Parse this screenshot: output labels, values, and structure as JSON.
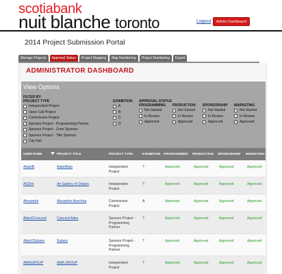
{
  "header": {
    "brand_top": "scotiabank",
    "brand_main": "nuit blanche",
    "brand_city": "toronto",
    "logout": "Logout",
    "admin_dashboard": "Admin Dashboard"
  },
  "portal_title": "2014 Project Submission Portal",
  "tabs": [
    {
      "label": "Manage Projects",
      "active": false
    },
    {
      "label": "Approval Status",
      "active": true
    },
    {
      "label": "Project Mapping",
      "active": false
    },
    {
      "label": "Map Numbering",
      "active": false
    },
    {
      "label": "Project Numbering",
      "active": false
    },
    {
      "label": "Export",
      "active": false
    }
  ],
  "dashboard_title": "ADMINISTRATOR DASHBOARD",
  "filters": {
    "heading": "View Options",
    "project_type": {
      "label_line1": "FILTER BY:",
      "label_line2": "PROJECT TYPE",
      "options": [
        "Independent Project",
        "Open Call Project",
        "Commission Project",
        "Sponsor Project - Programming Partner",
        "Sponsor Project - Zone Sponsor",
        "Sponsor Project - Title Sponsor",
        "City Hall"
      ]
    },
    "exhibition": {
      "label": "EXHIBITION",
      "options": [
        "A",
        "B",
        "C",
        "D"
      ]
    },
    "approval_status": {
      "label": "APPROVAL STATUS"
    },
    "programming": {
      "label": "PROGRAMMING",
      "options": [
        "Not Started",
        "In Review",
        "Approved"
      ]
    },
    "production": {
      "label": "PRODUCTION",
      "options": [
        "Not Started",
        "In Review",
        "Approved"
      ]
    },
    "sponsorship": {
      "label": "SPONSORSHIP",
      "options": [
        "Not Started",
        "In Review",
        "Approved"
      ]
    },
    "marketing": {
      "label": "MARKETING",
      "options": [
        "Not Started",
        "In Review",
        "Approved"
      ]
    }
  },
  "table": {
    "columns": [
      "USER NAME",
      "PROJECT TITLE",
      "PROJECT TYPE",
      "EXHIBITION",
      "PROGRAMMING",
      "PRODUCTION",
      "SPONSORSHIP",
      "MARKETING"
    ],
    "rows": [
      {
        "user": "AdamB",
        "title": "AdamBalo",
        "type": "Independent Project",
        "exhibition": "?",
        "programming": "Approved",
        "production": "Approved",
        "sponsorship": "Approved",
        "marketing": "Approved"
      },
      {
        "user": "AGOnt",
        "title": "Art Gallery of Ontario",
        "type": "Independent Project",
        "exhibition": "?",
        "programming": "Approved",
        "production": "Approved",
        "sponsorship": "Approved",
        "marketing": "Approved"
      },
      {
        "user": "Alexandre",
        "title": "Alexandre Airechea",
        "type": "Commission Project",
        "exhibition": "A",
        "programming": "Approved",
        "production": "Approved",
        "sponsorship": "Approved",
        "marketing": "Approved"
      },
      {
        "user": "AllanOConcord",
        "title": "Concord Adex",
        "type": "Sponsor Project - Programming Partner",
        "exhibition": "?",
        "programming": "Approved",
        "production": "Approved",
        "sponsorship": "Approved",
        "marketing": "Approved"
      },
      {
        "user": "AllanOSubaru",
        "title": "Subaru",
        "type": "Sponsor Project - Programming Partner",
        "exhibition": "?",
        "programming": "Approved",
        "production": "Approved",
        "sponsorship": "Approved",
        "marketing": "Approved"
      },
      {
        "user": "AMAGROUP",
        "title": "AMA GROUP",
        "type": "Independent Project",
        "exhibition": "?",
        "programming": "Approved",
        "production": "Approved",
        "sponsorship": "Approved",
        "marketing": "Approved"
      }
    ]
  },
  "colors": {
    "brand_red": "#e41b23",
    "approved_green": "#2a9a2a",
    "link_blue": "#1a4aa8",
    "tab_gray": "#6a6a6a"
  }
}
